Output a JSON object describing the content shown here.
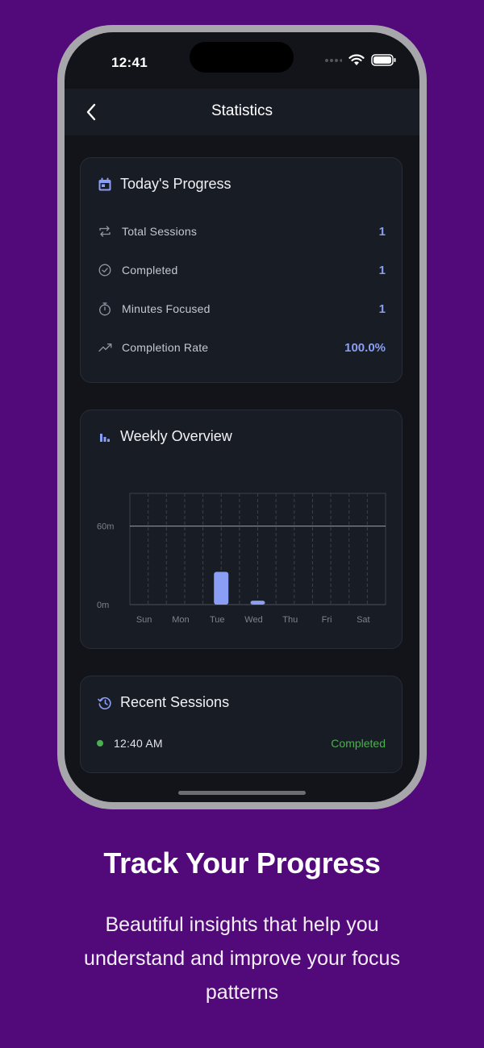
{
  "status_bar": {
    "time": "12:41"
  },
  "nav": {
    "title": "Statistics",
    "back_icon": "chevron-left-icon"
  },
  "today": {
    "title": "Today's Progress",
    "icon": "calendar-icon",
    "stats": [
      {
        "label": "Total Sessions",
        "value": "1",
        "icon": "repeat-icon"
      },
      {
        "label": "Completed",
        "value": "1",
        "icon": "check-circle-icon"
      },
      {
        "label": "Minutes Focused",
        "value": "1",
        "icon": "stopwatch-icon"
      },
      {
        "label": "Completion Rate",
        "value": "100.0%",
        "icon": "trending-up-icon"
      }
    ]
  },
  "weekly": {
    "title": "Weekly Overview",
    "icon": "bar-chart-icon"
  },
  "chart_data": {
    "type": "bar",
    "categories": [
      "Sun",
      "Mon",
      "Tue",
      "Wed",
      "Thu",
      "Fri",
      "Sat"
    ],
    "values": [
      0,
      0,
      25,
      3,
      0,
      0,
      0
    ],
    "ytick_labels": [
      "0m",
      "60m"
    ],
    "yticks": [
      0,
      60
    ],
    "ylim": [
      0,
      85
    ],
    "bar_color": "#8b9ef5",
    "grid": true
  },
  "recent": {
    "title": "Recent Sessions",
    "icon": "history-icon",
    "sessions": [
      {
        "time": "12:40 AM",
        "status": "Completed"
      }
    ]
  },
  "marketing": {
    "headline": "Track Your Progress",
    "subtext": "Beautiful insights that help you understand and improve your focus patterns"
  },
  "colors": {
    "accent": "#8b9ef5",
    "success": "#4caf50",
    "background": "#52097a"
  }
}
